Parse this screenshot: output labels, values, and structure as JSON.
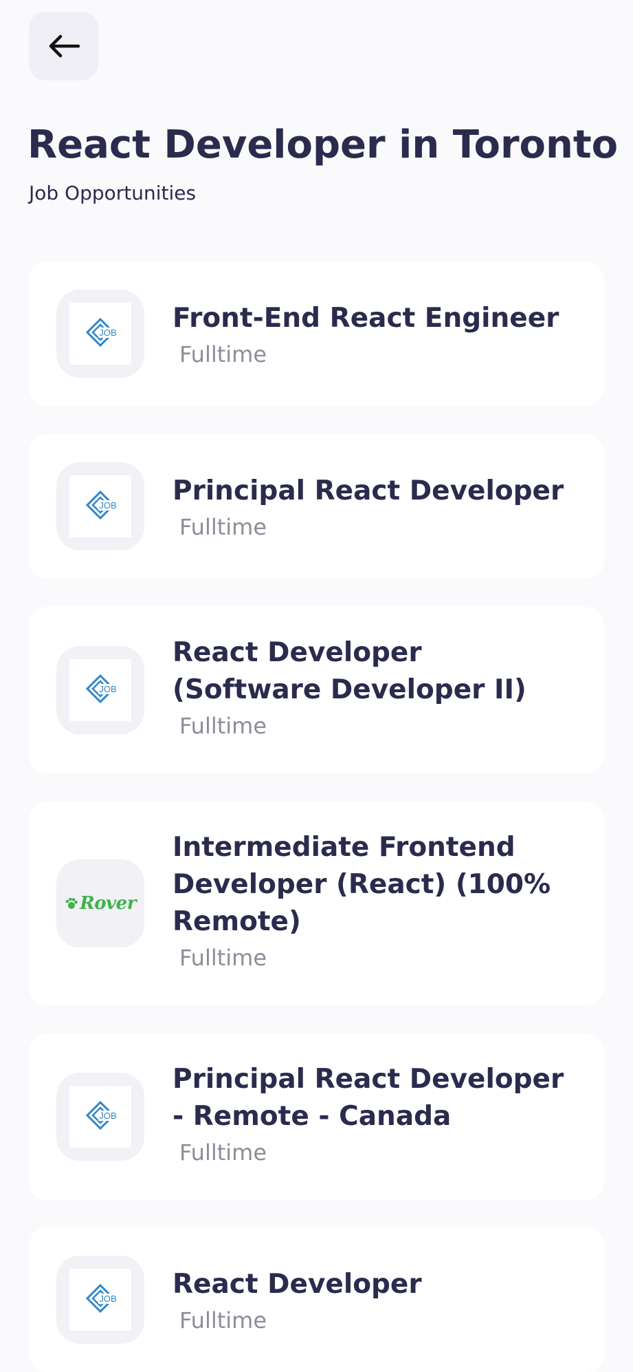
{
  "header": {
    "title": "React Developer in Toronto",
    "subtitle": "Job Opportunities"
  },
  "colors": {
    "background": "#FAF9FB",
    "card": "#FFFFFF",
    "text_primary": "#2A2B4D",
    "text_secondary": "#8D8D99",
    "logo_tile": "#F1F1F6",
    "job_logo_blue": "#2E86C8",
    "rover_green": "#3FB24A"
  },
  "icons": {
    "back": "arrow-left-icon",
    "job_logo": "job-diamond-logo",
    "rover_logo": "rover-logo"
  },
  "jobs": [
    {
      "title": "Front-End React Engineer",
      "type": "Fulltime",
      "logo_text": "JOB"
    },
    {
      "title": "Principal React Developer",
      "type": "Fulltime",
      "logo_text": "JOB"
    },
    {
      "title": "React Developer (Software Developer II)",
      "type": "Fulltime",
      "logo_text": "JOB"
    },
    {
      "title": "Intermediate Frontend Developer (React) (100% Remote)",
      "type": "Fulltime",
      "logo_text": "Rover"
    },
    {
      "title": "Principal React Developer - Remote - Canada",
      "type": "Fulltime",
      "logo_text": "JOB"
    },
    {
      "title": "React Developer",
      "type": "Fulltime",
      "logo_text": "JOB"
    }
  ]
}
